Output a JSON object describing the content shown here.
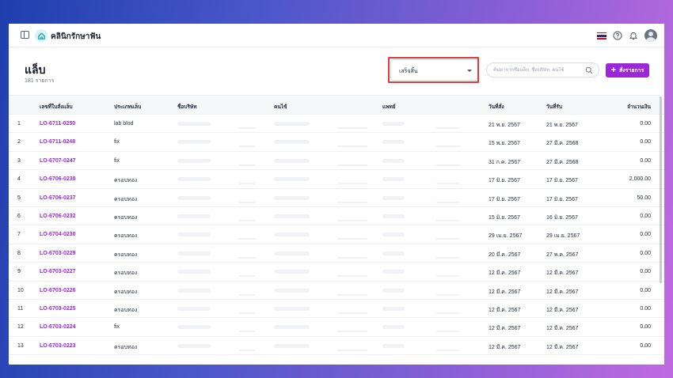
{
  "app": {
    "title": "คลินิกรักษาฟัน",
    "colors": {
      "accent": "#9b27d8",
      "highlight": "#e53935"
    },
    "icons": [
      "sidebar-toggle-icon",
      "tooth-logo-icon",
      "thai-flag-icon",
      "help-icon",
      "bell-icon",
      "avatar"
    ]
  },
  "page": {
    "title": "แล็บ",
    "count": "181 รายการ"
  },
  "filters": {
    "status_value": "เสร็จสิ้น",
    "search_placeholder": "ค้นหาจากชื่อแล็บ, ชื่อบริษัท, คนไข้",
    "add_label": "สั่งรายการ"
  },
  "table": {
    "headers": {
      "code": "เลขที่ใบสั่งแล็บ",
      "type": "ประเภทแล็บ",
      "company": "ชื่อบริษัท",
      "patient": "คนไข้",
      "doctor": "แพทย์",
      "ordered": "วันที่สั่ง",
      "received": "วันที่รับ",
      "amount": "จำนวนเงิน"
    },
    "rows": [
      {
        "no": "1",
        "code": "LO-6711-0250",
        "type": "lab blod",
        "ordered": "21 พ.ย. 2567",
        "received": "21 พ.ย. 2567",
        "amount": "0.00"
      },
      {
        "no": "2",
        "code": "LO-6711-0248",
        "type": "fix",
        "ordered": "15 พ.ย. 2567",
        "received": "27 มี.ค. 2568",
        "amount": "0.00"
      },
      {
        "no": "3",
        "code": "LO-6707-0247",
        "type": "fix",
        "ordered": "31 ก.ค. 2567",
        "received": "27 มี.ค. 2568",
        "amount": "0.00"
      },
      {
        "no": "4",
        "code": "LO-6706-0238",
        "type": "ครอบทอง",
        "ordered": "17 มิ.ย. 2567",
        "received": "17 มิ.ย. 2567",
        "amount": "2,000.00"
      },
      {
        "no": "5",
        "code": "LO-6706-0237",
        "type": "ครอบทอง",
        "ordered": "17 มิ.ย. 2567",
        "received": "17 มิ.ย. 2567",
        "amount": "50.00"
      },
      {
        "no": "6",
        "code": "LO-6706-0232",
        "type": "ครอบทอง",
        "ordered": "15 มิ.ย. 2567",
        "received": "16 มิ.ย. 2567",
        "amount": "0.00"
      },
      {
        "no": "7",
        "code": "LO-6704-0230",
        "type": "ครอบทอง",
        "ordered": "29 เม.ย. 2567",
        "received": "29 เม.ย. 2567",
        "amount": "0.00"
      },
      {
        "no": "8",
        "code": "LO-6703-0229",
        "type": "ครอบทอง",
        "ordered": "20 มี.ค. 2567",
        "received": "27 พ.ค. 2567",
        "amount": "0.00"
      },
      {
        "no": "9",
        "code": "LO-6703-0227",
        "type": "ครอบทอง",
        "ordered": "12 มี.ค. 2567",
        "received": "12 มี.ค. 2567",
        "amount": "0.00"
      },
      {
        "no": "10",
        "code": "LO-6703-0226",
        "type": "ครอบทอง",
        "ordered": "12 มี.ค. 2567",
        "received": "12 มี.ค. 2567",
        "amount": "0.00"
      },
      {
        "no": "11",
        "code": "LO-6703-0225",
        "type": "ครอบทอง",
        "ordered": "12 มี.ค. 2567",
        "received": "12 มี.ค. 2567",
        "amount": "0.00"
      },
      {
        "no": "12",
        "code": "LO-6703-0224",
        "type": "fix",
        "ordered": "12 มี.ค. 2567",
        "received": "12 มี.ค. 2567",
        "amount": "0.00"
      },
      {
        "no": "13",
        "code": "LO-6703-0223",
        "type": "ครอบทอง",
        "ordered": "12 มี.ค. 2567",
        "received": "12 มี.ค. 2567",
        "amount": "0.00"
      }
    ]
  }
}
